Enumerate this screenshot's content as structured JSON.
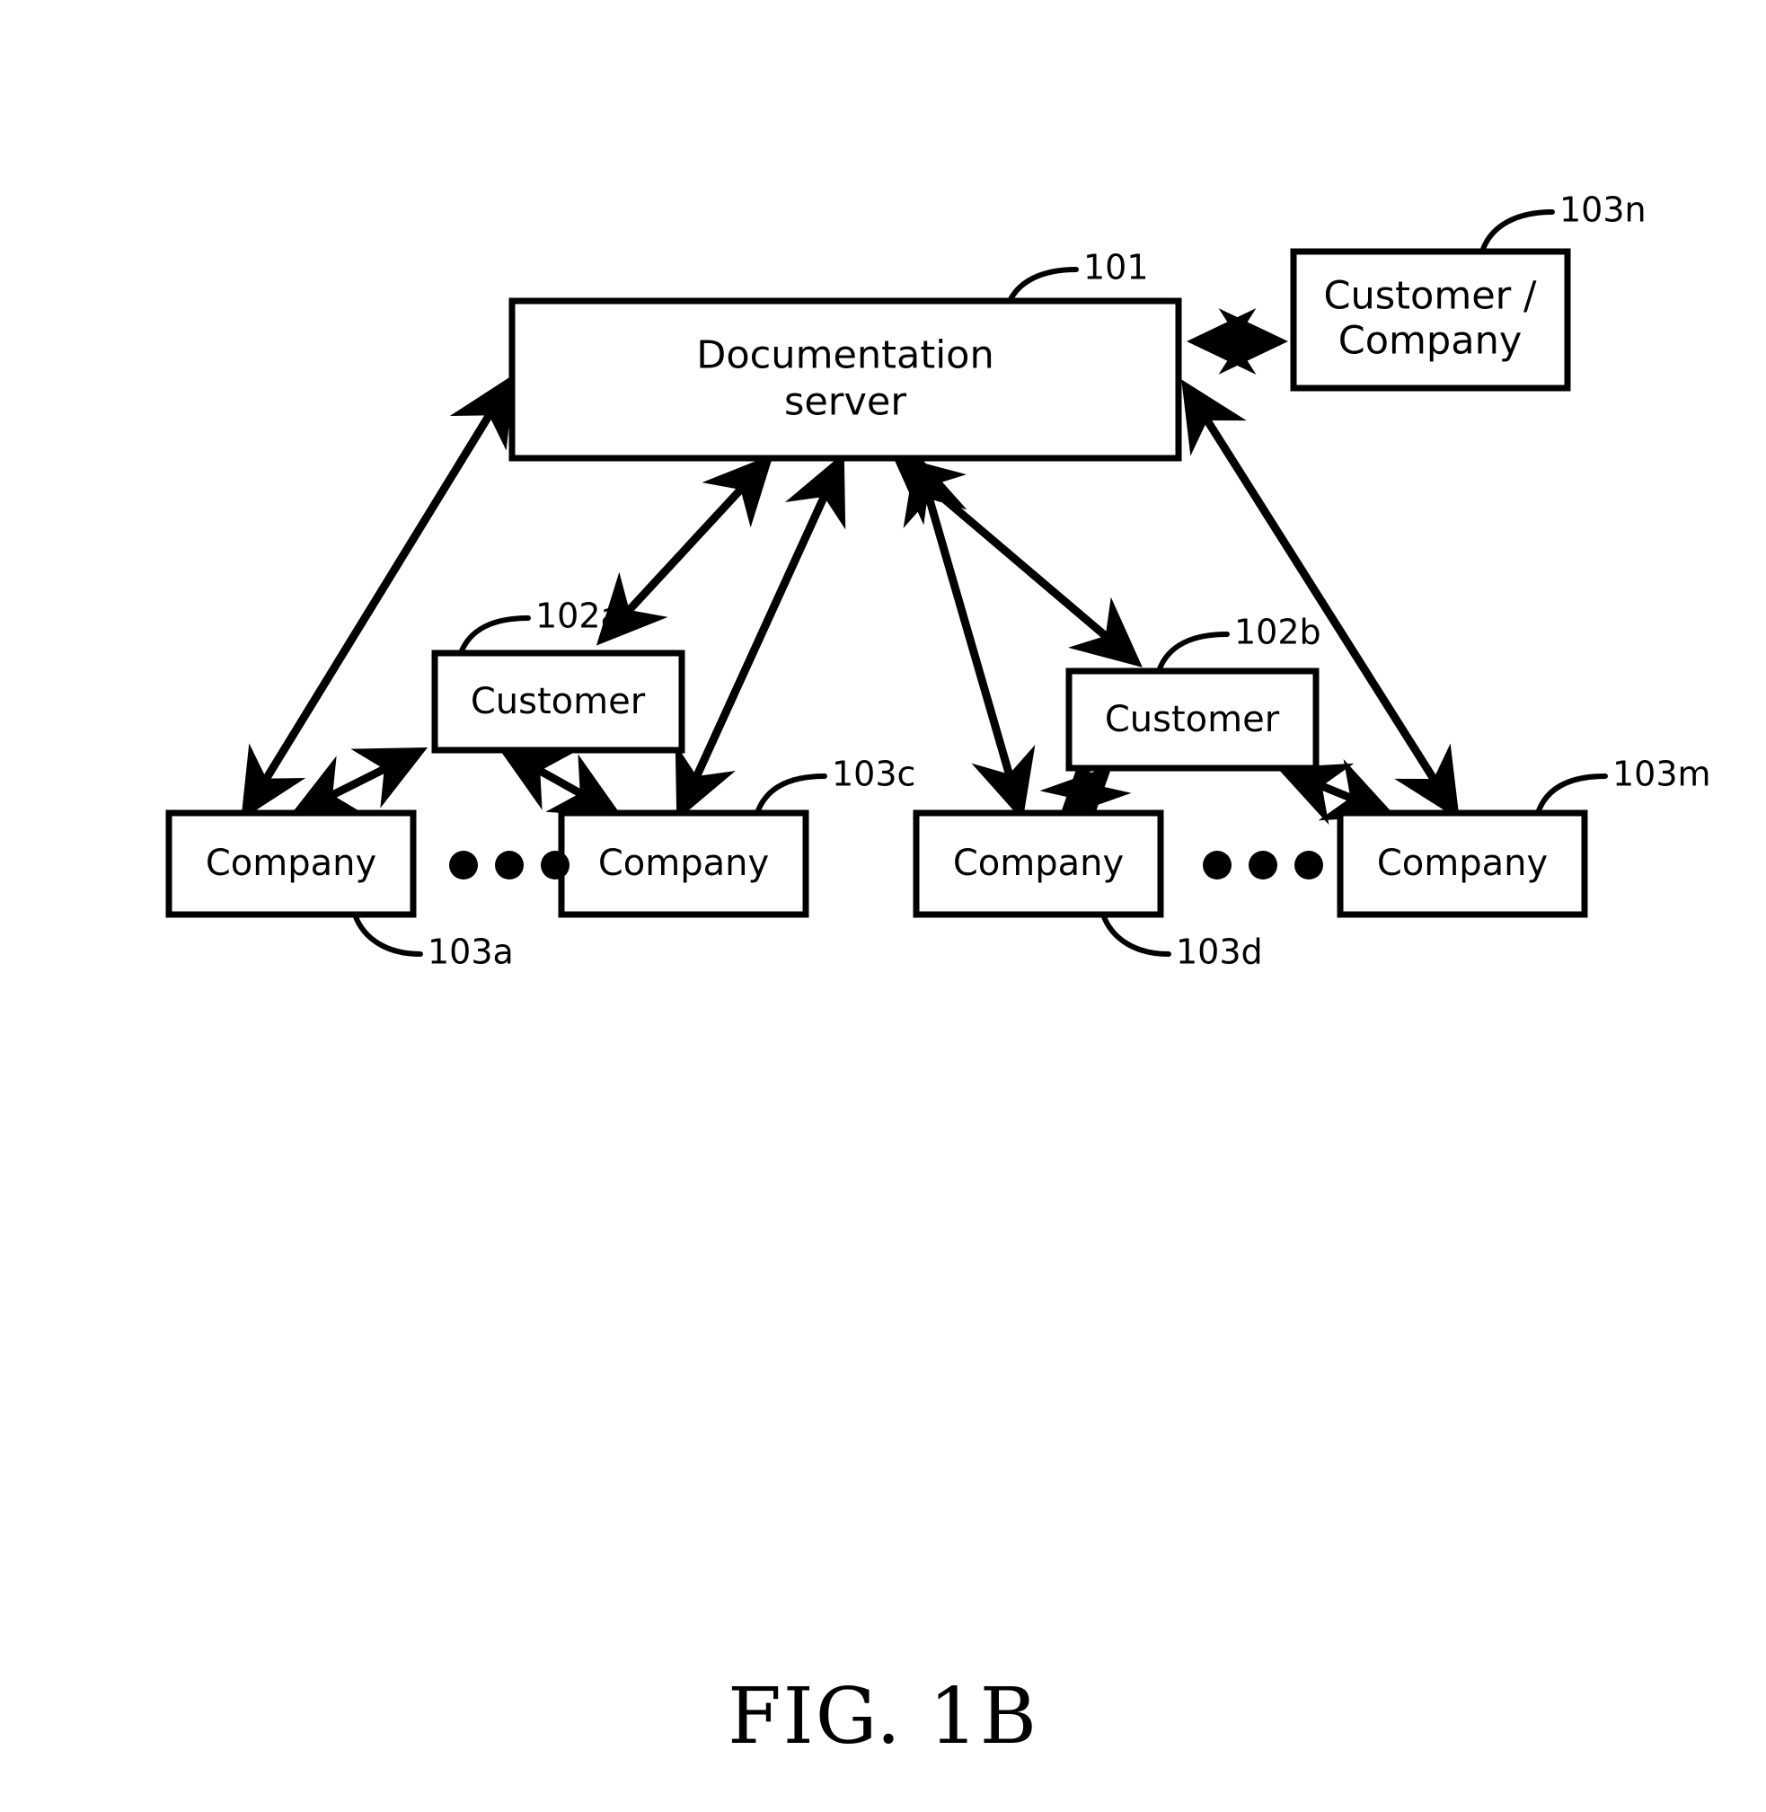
{
  "figure": {
    "caption": "FIG. 1B"
  },
  "nodes": {
    "server": {
      "line1": "Documentation",
      "line2": "server",
      "ref": "101"
    },
    "customer_company_top": {
      "line1": "Customer /",
      "line2": "Company",
      "ref": "103n"
    },
    "customer_a": {
      "label": "Customer",
      "ref": "102a"
    },
    "customer_b": {
      "label": "Customer",
      "ref": "102b"
    },
    "company_a": {
      "label": "Company",
      "ref": "103a"
    },
    "company_c": {
      "label": "Company",
      "ref": "103c"
    },
    "company_d": {
      "label": "Company",
      "ref": "103d"
    },
    "company_m": {
      "label": "Company",
      "ref": "103m"
    }
  },
  "ellipsis": {
    "left": "• • •",
    "right": "• • •"
  },
  "colors": {
    "stroke": "#000000",
    "fill": "#ffffff",
    "text": "#000000"
  }
}
